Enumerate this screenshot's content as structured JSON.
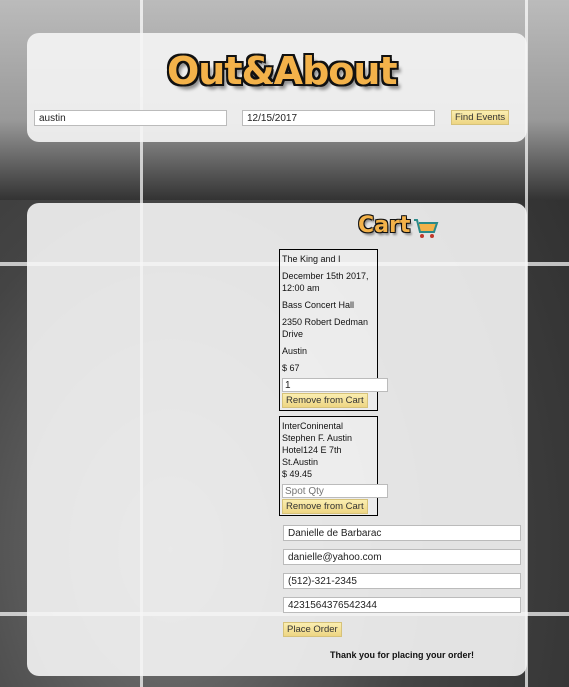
{
  "header": {
    "logo": "Out&About",
    "location_value": "austin",
    "date_value": "12/15/2017",
    "find_label": "Find Events"
  },
  "cart": {
    "title": "Cart",
    "cart_icon": "shopping-cart-icon",
    "items": [
      {
        "name": "The King and I",
        "date": "December 15th 2017, 12:00 am",
        "venue": "Bass Concert Hall",
        "address": "2350 Robert Dedman Drive",
        "city": "Austin",
        "price": "$ 67",
        "qty_value": "1",
        "remove_label": "Remove from Cart"
      },
      {
        "name": "InterConinental Stephen F. Austin Hotel124 E 7th St.Austin",
        "price": "$ 49.45",
        "qty_placeholder": "Spot Qty",
        "remove_label": "Remove from Cart"
      }
    ]
  },
  "order": {
    "name": "Danielle de Barbarac",
    "email": "danielle@yahoo.com",
    "phone": "(512)-321-2345",
    "card": "4231564376542344",
    "place_label": "Place Order",
    "message": "Thank you for placing your order!"
  }
}
